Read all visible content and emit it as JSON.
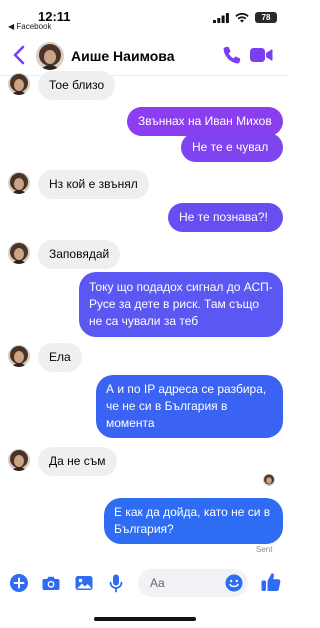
{
  "status_bar": {
    "time": "12:11",
    "back_app": "◀ Facebook",
    "battery": "78"
  },
  "header": {
    "contact_name": "Аише Наимова"
  },
  "colors": {
    "accent": "#7b3ff2",
    "bubble_purple": "#8a3ef0",
    "bubble_indigo": "#5b55f2",
    "bubble_blue": "#2d6cf3",
    "incoming_bubble": "#efefef"
  },
  "messages": [
    {
      "from": "them",
      "text": "Тое близо"
    },
    {
      "from": "me",
      "text": "Звъннах на Иван Михов"
    },
    {
      "from": "me",
      "text": "Не те е чувал"
    },
    {
      "from": "them",
      "text": "Нз кой е звънял"
    },
    {
      "from": "me",
      "text": "Не те познава?!"
    },
    {
      "from": "them",
      "text": "Заповядай"
    },
    {
      "from": "me",
      "text": "Току що подадох сигнал до АСП-Русе за дете в риск. Там също не са чували за теб"
    },
    {
      "from": "them",
      "text": "Ела"
    },
    {
      "from": "me",
      "text": "А и по IP адреса се разбира, че не си в България в момента"
    },
    {
      "from": "them",
      "text": "Да не съм"
    },
    {
      "from": "me",
      "text": "Е как да дойда, като не си в България?"
    }
  ],
  "delivery_status": "Sent",
  "composer": {
    "placeholder": "Aa",
    "icons": [
      "plus-icon",
      "camera-icon",
      "gallery-icon",
      "microphone-icon",
      "emoji-icon",
      "thumbs-up-icon"
    ]
  }
}
